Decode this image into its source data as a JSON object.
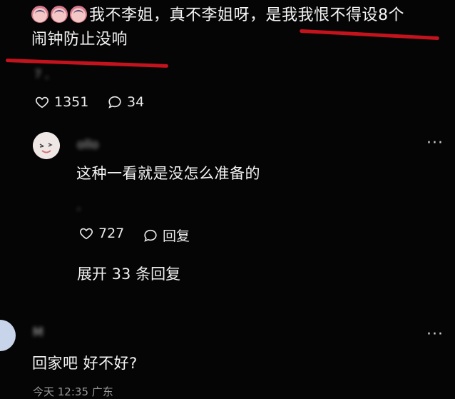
{
  "top_comment": {
    "text_line1": "我不李姐，真不李姐呀，是我我恨不得设8个",
    "text_line2": "闹钟防止没响",
    "meta": "7 ,",
    "like_count": "1351",
    "reply_count": "34"
  },
  "reply": {
    "username": "ollo",
    "text": "这种一看就是没怎么准备的",
    "meta": ",",
    "like_count": "727",
    "reply_label": "回复",
    "expand_label": "展开 33 条回复"
  },
  "next_comment": {
    "username": "M",
    "text": "回家吧 好不好?",
    "meta": "今天 12:35 广东"
  },
  "colors": {
    "background": "#050505",
    "annotation_red": "#c4131c"
  },
  "icons": [
    "heart-icon",
    "comment-icon",
    "more-icon"
  ]
}
